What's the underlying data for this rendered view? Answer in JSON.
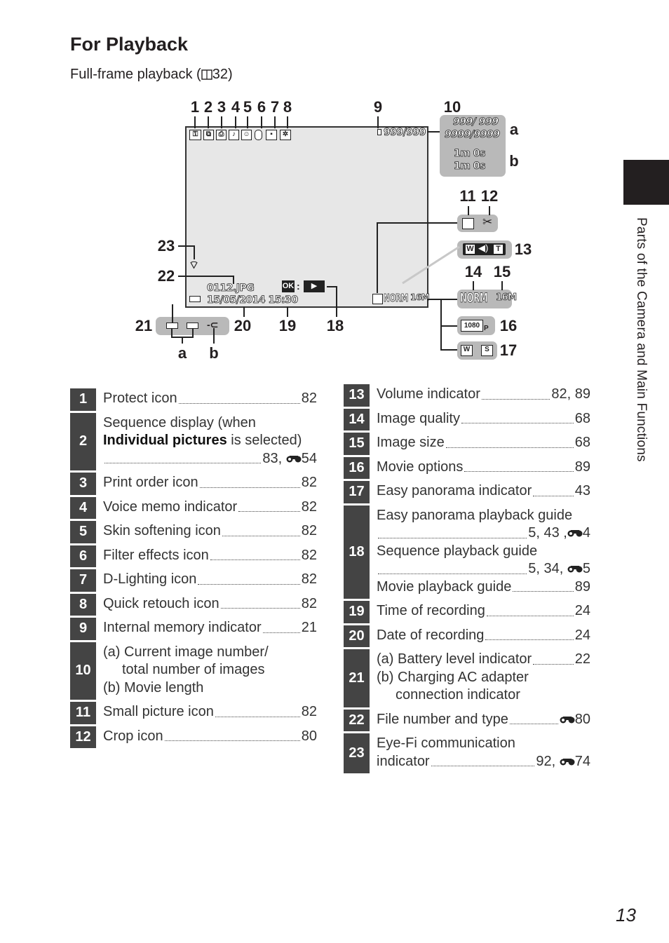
{
  "heading": "For Playback",
  "subheading": {
    "text": "Full-frame playback (",
    "ref_page": "32",
    "close": ")"
  },
  "side_tab": {
    "text": "Parts of the Camera and Main Functions"
  },
  "page_number": "13",
  "diagram": {
    "callouts": [
      "1",
      "2",
      "3",
      "4",
      "5",
      "6",
      "7",
      "8",
      "9",
      "10",
      "a",
      "b",
      "11",
      "12",
      "13",
      "14",
      "15",
      "16",
      "17",
      "18",
      "19",
      "20",
      "21",
      "a",
      "b",
      "22",
      "23"
    ],
    "screen": {
      "frame_counter": "999/999",
      "file_name": "0112.JPG",
      "date_time": "15/05/2014 15:30",
      "ok_label": "OK",
      "play_symbol": "▶",
      "quality": "NORM",
      "size": "16M"
    },
    "box10": {
      "a1": "999/ 999",
      "a2": "9999/9999",
      "b1": "1m 0s",
      "b2": "1m 0s"
    },
    "box13": {
      "w": "W",
      "t": "T"
    },
    "box14_15": {
      "quality": "NORM",
      "size": "16M"
    },
    "box16": {
      "movie": "1080",
      "p": "P"
    }
  },
  "left_items": [
    {
      "num": "1",
      "lines": [
        {
          "text": "Protect icon",
          "page": "82"
        }
      ]
    },
    {
      "num": "2",
      "lines": [
        {
          "text": "Sequence display (when"
        },
        {
          "bold": "Individual pictures",
          "text": " is selected)"
        },
        {
          "text": "",
          "page": "83, ",
          "ref": "54"
        }
      ]
    },
    {
      "num": "3",
      "lines": [
        {
          "text": "Print order icon",
          "page": "82"
        }
      ]
    },
    {
      "num": "4",
      "lines": [
        {
          "text": "Voice memo indicator",
          "page": "82"
        }
      ]
    },
    {
      "num": "5",
      "lines": [
        {
          "text": "Skin softening icon",
          "page": "82"
        }
      ]
    },
    {
      "num": "6",
      "lines": [
        {
          "text": "Filter effects icon",
          "page": "82"
        }
      ]
    },
    {
      "num": "7",
      "lines": [
        {
          "text": "D-Lighting icon",
          "page": "82"
        }
      ]
    },
    {
      "num": "8",
      "lines": [
        {
          "text": "Quick retouch icon",
          "page": "82"
        }
      ]
    },
    {
      "num": "9",
      "lines": [
        {
          "text": "Internal memory indicator",
          "page": "21"
        }
      ]
    },
    {
      "num": "10",
      "lines": [
        {
          "text": "(a) Current image number/"
        },
        {
          "text": "total number of images",
          "indent": true
        },
        {
          "text": "(b) Movie length"
        }
      ]
    },
    {
      "num": "11",
      "lines": [
        {
          "text": "Small picture icon",
          "page": "82"
        }
      ]
    },
    {
      "num": "12",
      "lines": [
        {
          "text": "Crop icon",
          "page": "80"
        }
      ]
    }
  ],
  "right_items": [
    {
      "num": "13",
      "lines": [
        {
          "text": "Volume indicator",
          "page": "82, 89"
        }
      ]
    },
    {
      "num": "14",
      "lines": [
        {
          "text": "Image quality",
          "page": "68"
        }
      ]
    },
    {
      "num": "15",
      "lines": [
        {
          "text": "Image size",
          "page": "68"
        }
      ]
    },
    {
      "num": "16",
      "lines": [
        {
          "text": "Movie options",
          "page": "89"
        }
      ]
    },
    {
      "num": "17",
      "lines": [
        {
          "text": "Easy panorama indicator",
          "page": "43"
        }
      ]
    },
    {
      "num": "18",
      "lines": [
        {
          "text": "Easy panorama playback guide"
        },
        {
          "text": "",
          "page": "5, 43 ,",
          "ref": "4"
        },
        {
          "text": "Sequence playback guide"
        },
        {
          "text": "",
          "page": "5, 34, ",
          "ref": "5"
        },
        {
          "text": "Movie playback guide",
          "page": "89"
        }
      ]
    },
    {
      "num": "19",
      "lines": [
        {
          "text": "Time of recording",
          "page": "24"
        }
      ]
    },
    {
      "num": "20",
      "lines": [
        {
          "text": "Date of recording",
          "page": "24"
        }
      ]
    },
    {
      "num": "21",
      "lines": [
        {
          "text": "(a) Battery level indicator",
          "page": "22"
        },
        {
          "text": "(b) Charging AC adapter"
        },
        {
          "text": "connection indicator",
          "indent": true
        }
      ]
    },
    {
      "num": "22",
      "lines": [
        {
          "text": "File number and type",
          "page": "",
          "ref": "80"
        }
      ]
    },
    {
      "num": "23",
      "lines": [
        {
          "text": "Eye-Fi communication"
        },
        {
          "text": "indicator",
          "page": "92, ",
          "ref": "74"
        }
      ]
    }
  ],
  "colors": {
    "number_box": "#444444",
    "osd_box": "#b9b9b9",
    "screen": "#e7e7e7",
    "side_tab": "#231f20"
  }
}
